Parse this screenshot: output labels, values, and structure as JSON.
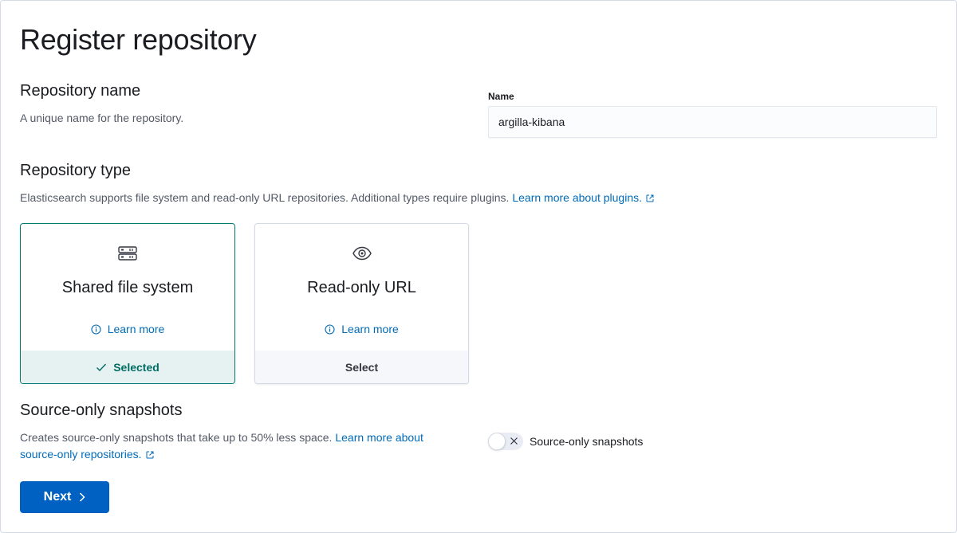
{
  "page": {
    "title": "Register repository"
  },
  "repository_name": {
    "title": "Repository name",
    "description": "A unique name for the repository.",
    "field_label": "Name",
    "value": "argilla-kibana"
  },
  "repository_type": {
    "title": "Repository type",
    "description": "Elasticsearch supports file system and read-only URL repositories. Additional types require plugins.",
    "link": "Learn more about plugins.",
    "cards": [
      {
        "title": "Shared file system",
        "learn_more": "Learn more",
        "footer": "Selected",
        "state": "selected",
        "icon": "storage-icon"
      },
      {
        "title": "Read-only URL",
        "learn_more": "Learn more",
        "footer": "Select",
        "state": "unselected",
        "icon": "eye-icon"
      }
    ]
  },
  "source_only": {
    "title": "Source-only snapshots",
    "description": "Creates source-only snapshots that take up to 50% less space.",
    "link_line1": "Learn more about",
    "link_line2": "source-only repositories.",
    "toggle_label": "Source-only snapshots",
    "toggle_on": false
  },
  "actions": {
    "next_label": "Next"
  },
  "colors": {
    "link": "#006bb8",
    "selected_border": "#017d73",
    "selected_bg": "#e6f2f1",
    "primary": "#0061c2"
  }
}
